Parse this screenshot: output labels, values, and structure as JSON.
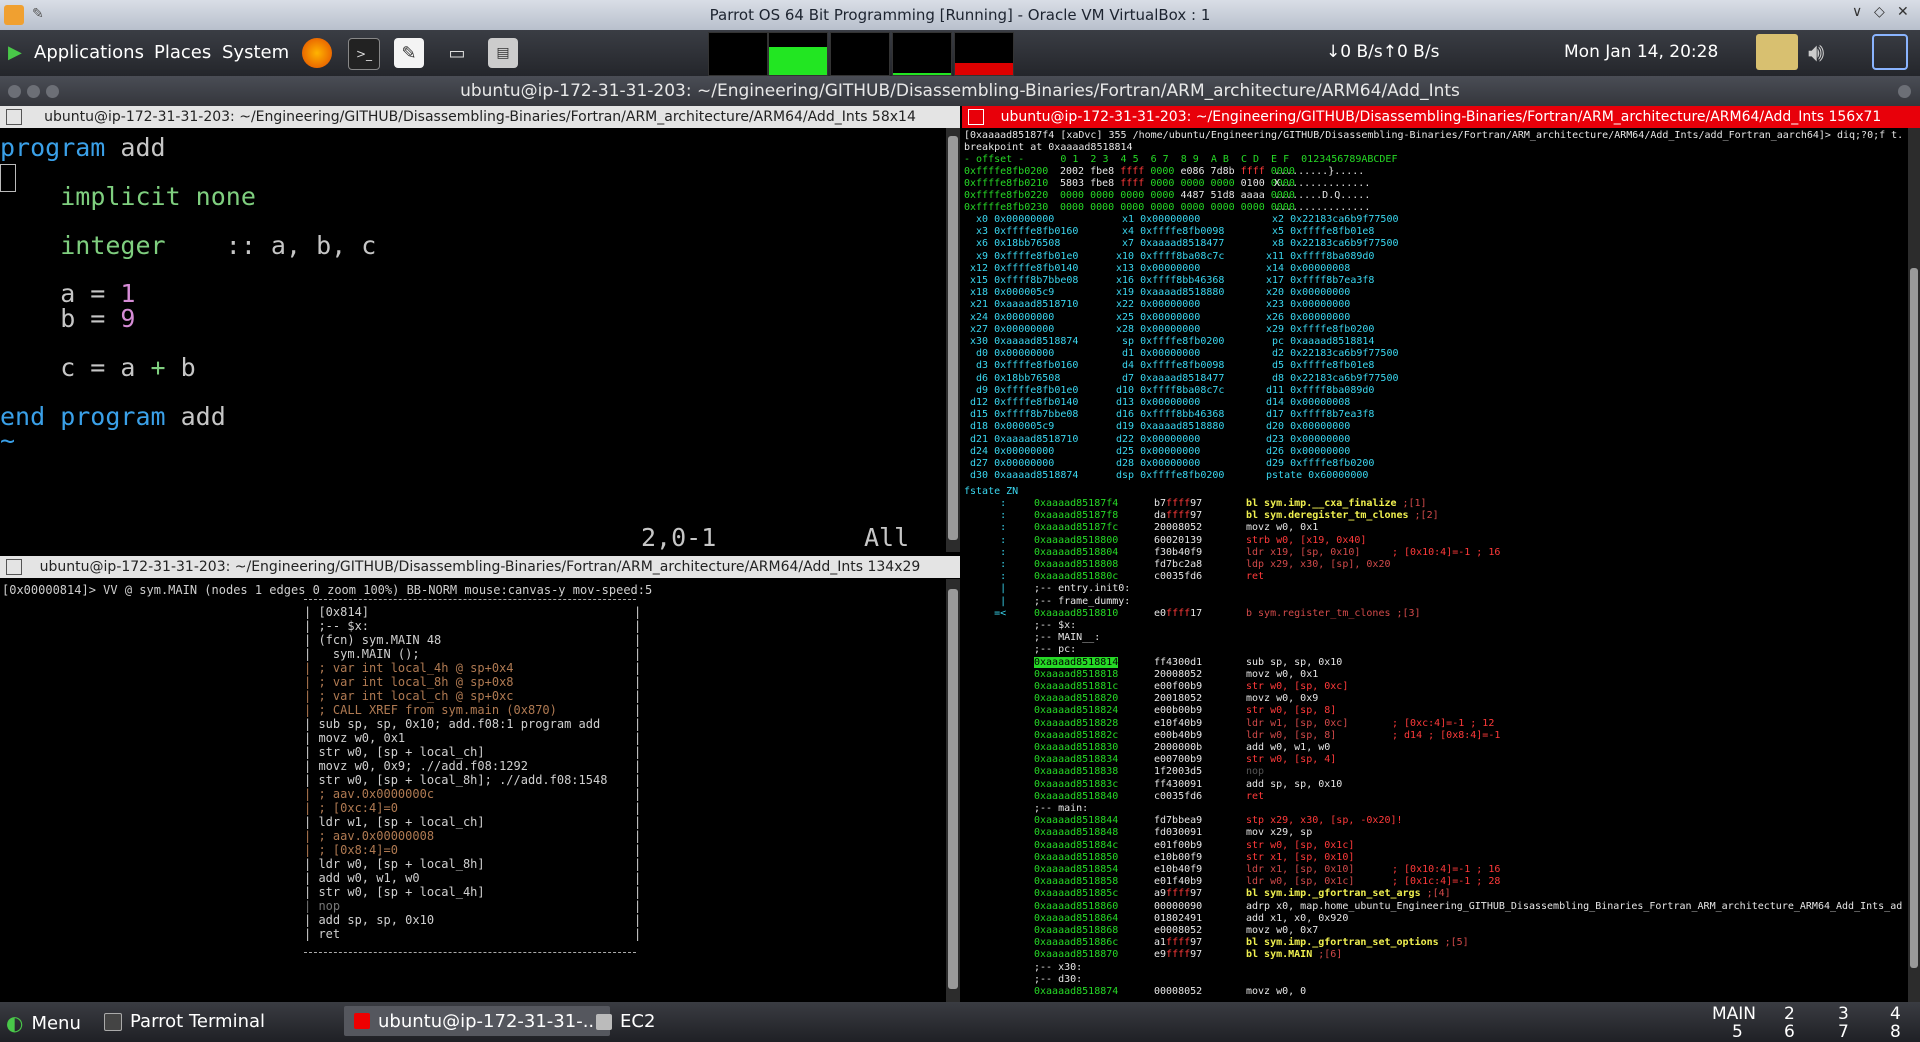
{
  "vbox": {
    "title": "Parrot OS 64 Bit Programming [Running] - Oracle VM VirtualBox : 1"
  },
  "panel": {
    "menus": [
      "Applications",
      "Places",
      "System"
    ],
    "network": "↓0 B/s↑0 B/s",
    "clock": "Mon Jan 14, 20:28"
  },
  "terminal": {
    "title": "ubuntu@ip-172-31-31-203: ~/Engineering/GITHUB/Disassembling-Binaries/Fortran/ARM_architecture/ARM64/Add_Ints"
  },
  "pane_vim": {
    "title": "ubuntu@ip-172-31-31-203: ~/Engineering/GITHUB/Disassembling-Binaries/Fortran/ARM_architecture/ARM64/Add_Ints 58x14",
    "status_pos": "2,0-1",
    "status_all": "All"
  },
  "pane_graph": {
    "title": "ubuntu@ip-172-31-31-203: ~/Engineering/GITHUB/Disassembling-Binaries/Fortran/ARM_architecture/ARM64/Add_Ints 134x29",
    "header": "[0x00000814]> VV @ sym.MAIN (nodes 1 edges 0 zoom 100%) BB-NORM mouse:canvas-y mov-speed:5",
    "lines": [
      {
        "t": "| [0x814]",
        "c": "n"
      },
      {
        "t": "| ;-- $x:",
        "c": "n"
      },
      {
        "t": "| (fcn) sym.MAIN 48",
        "c": "n"
      },
      {
        "t": "|   sym.MAIN ();",
        "c": "n"
      },
      {
        "t": "| ; var int local_4h @ sp+0x4",
        "c": "c"
      },
      {
        "t": "| ; var int local_8h @ sp+0x8",
        "c": "c"
      },
      {
        "t": "| ; var int local_ch @ sp+0xc",
        "c": "c"
      },
      {
        "t": "| ; CALL XREF from sym.main (0x870)",
        "c": "c"
      },
      {
        "t": "| sub sp, sp, 0x10; add.f08:1 program add",
        "c": "n"
      },
      {
        "t": "| movz w0, 0x1",
        "c": "n"
      },
      {
        "t": "| str w0, [sp + local_ch]",
        "c": "n"
      },
      {
        "t": "| movz w0, 0x9; .//add.f08:1292",
        "c": "n"
      },
      {
        "t": "| str w0, [sp + local_8h]; .//add.f08:1548",
        "c": "n"
      },
      {
        "t": "| ; aav.0x0000000c",
        "c": "c"
      },
      {
        "t": "| ; [0xc:4]=0",
        "c": "c"
      },
      {
        "t": "| ldr w1, [sp + local_ch]",
        "c": "n"
      },
      {
        "t": "| ; aav.0x00000008",
        "c": "c"
      },
      {
        "t": "| ; [0x8:4]=0",
        "c": "c"
      },
      {
        "t": "| ldr w0, [sp + local_8h]",
        "c": "n"
      },
      {
        "t": "| add w0, w1, w0",
        "c": "n"
      },
      {
        "t": "| str w0, [sp + local_4h]",
        "c": "n"
      },
      {
        "t": "| nop",
        "c": "g"
      },
      {
        "t": "| add sp, sp, 0x10",
        "c": "n"
      },
      {
        "t": "| ret",
        "c": "n"
      }
    ]
  },
  "pane_r2": {
    "title": "ubuntu@ip-172-31-31-203: ~/Engineering/GITHUB/Disassembling-Binaries/Fortran/ARM_architecture/ARM64/Add_Ints 156x71",
    "cmd": "[0xaaaad85187f4 [xaDvc] 355 /home/ubuntu/Engineering/GITHUB/Disassembling-Binaries/Fortran/ARM_architecture/ARM64/Add_Ints/add_Fortran_aarch64]> diq;?0;f t.",
    "breakpoint": "breakpoint at 0xaaaad8518814",
    "hexhdr": "- offset -      0 1  2 3  4 5  6 7  8 9  A B  C D  E F  0123456789ABCDEF",
    "hex": [
      {
        "a": "0xffffe8fb0200",
        "b": "2002 fbe8 ffff 0000 e086 7d8b ffff 0000",
        "s": " .........}....."
      },
      {
        "a": "0xffffe8fb0210",
        "b": "5803 fbe8 ffff 0000 0000 0000 0100 0000",
        "s": " X..............."
      },
      {
        "a": "0xffffe8fb0220",
        "b": "0000 0000 0000 0000 4487 51d8 aaaa 0000",
        "s": " ........D.Q....."
      },
      {
        "a": "0xffffe8fb0230",
        "b": "0000 0000 0000 0000 0000 0000 0000 0000",
        "s": " ................"
      }
    ],
    "regs": [
      [
        "  x0 0x00000000",
        "  x1 0x00000000",
        "  x2 0x22183ca6b9f77500"
      ],
      [
        "  x3 0xffffe8fb0160",
        "  x4 0xffffe8fb0098",
        "  x5 0xffffe8fb01e8"
      ],
      [
        "  x6 0x18bb76508",
        "  x7 0xaaaad8518477",
        "  x8 0x22183ca6b9f77500"
      ],
      [
        "  x9 0xffffe8fb01e0",
        " x10 0xffff8ba08c7c",
        " x11 0xffff8ba089d0"
      ],
      [
        " x12 0xffffe8fb0140",
        " x13 0x00000000",
        " x14 0x00000008"
      ],
      [
        " x15 0xffff8b7bbe08",
        " x16 0xffff8bb46368",
        " x17 0xffff8b7ea3f8"
      ],
      [
        " x18 0x000005c9",
        " x19 0xaaaad8518880",
        " x20 0x00000000"
      ],
      [
        " x21 0xaaaad8518710",
        " x22 0x00000000",
        " x23 0x00000000"
      ],
      [
        " x24 0x00000000",
        " x25 0x00000000",
        " x26 0x00000000"
      ],
      [
        " x27 0x00000000",
        " x28 0x00000000",
        " x29 0xffffe8fb0200"
      ],
      [
        " x30 0xaaaad8518874",
        "  sp 0xffffe8fb0200",
        "  pc 0xaaaad8518814"
      ],
      [
        "  d0 0x00000000",
        "  d1 0x00000000",
        "  d2 0x22183ca6b9f77500"
      ],
      [
        "  d3 0xffffe8fb0160",
        "  d4 0xffffe8fb0098",
        "  d5 0xffffe8fb01e8"
      ],
      [
        "  d6 0x18bb76508",
        "  d7 0xaaaad8518477",
        "  d8 0x22183ca6b9f77500"
      ],
      [
        "  d9 0xffffe8fb01e0",
        " d10 0xffff8ba08c7c",
        " d11 0xffff8ba089d0"
      ],
      [
        " d12 0xffffe8fb0140",
        " d13 0x00000000",
        " d14 0x00000008"
      ],
      [
        " d15 0xffff8b7bbe08",
        " d16 0xffff8bb46368",
        " d17 0xffff8b7ea3f8"
      ],
      [
        " d18 0x000005c9",
        " d19 0xaaaad8518880",
        " d20 0x00000000"
      ],
      [
        " d21 0xaaaad8518710",
        " d22 0x00000000",
        " d23 0x00000000"
      ],
      [
        " d24 0x00000000",
        " d25 0x00000000",
        " d26 0x00000000"
      ],
      [
        " d27 0x00000000",
        " d28 0x00000000",
        " d29 0xffffe8fb0200"
      ],
      [
        " d30 0xaaaad8518874",
        " dsp 0xffffe8fb0200",
        " pstate 0x60000000"
      ]
    ],
    "fstate": "fstate ZN",
    "disasm": [
      {
        "p": "      :",
        "a": "0xaaaad85187f4",
        "b": "b7ffff97",
        "i": "bl sym.imp.__cxa_finalize",
        "x": ";[1]",
        "k": "call"
      },
      {
        "p": "      :",
        "a": "0xaaaad85187f8",
        "b": "daffff97",
        "i": "bl sym.deregister_tm_clones",
        "x": ";[2]",
        "k": "call"
      },
      {
        "p": "      :",
        "a": "0xaaaad85187fc",
        "b": "20008052",
        "i": "movz w0, 0x1",
        "x": "",
        "k": "n"
      },
      {
        "p": "      :",
        "a": "0xaaaad8518800",
        "b": "60020139",
        "i": "strb w0, [x19, 0x40]",
        "x": "",
        "k": "st"
      },
      {
        "p": "      :",
        "a": "0xaaaad8518804",
        "b": "f30b40f9",
        "i": "ldr x19, [sp, 0x10]",
        "x": "; [0x10:4]=-1 ; 16",
        "k": "ld"
      },
      {
        "p": "      :",
        "a": "0xaaaad8518808",
        "b": "fd7bc2a8",
        "i": "ldp x29, x30, [sp], 0x20",
        "x": "",
        "k": "ld"
      },
      {
        "p": "      :",
        "a": "0xaaaad851880c",
        "b": "c0035fd6",
        "i": "ret",
        "x": "",
        "k": "ret"
      },
      {
        "p": "      |",
        "a": ";-- entry.init0:",
        "b": "",
        "i": "",
        "x": "",
        "k": "lbl"
      },
      {
        "p": "      |",
        "a": ";-- frame_dummy:",
        "b": "",
        "i": "",
        "x": "",
        "k": "lbl"
      },
      {
        "p": "     =<",
        "a": "0xaaaad8518810",
        "b": "e0ffff17",
        "i": "b sym.register_tm_clones",
        "x": ";[3]",
        "k": "jmp"
      },
      {
        "p": "       ",
        "a": ";-- $x:",
        "b": "",
        "i": "",
        "x": "",
        "k": "lbl"
      },
      {
        "p": "       ",
        "a": ";-- MAIN__:",
        "b": "",
        "i": "",
        "x": "",
        "k": "lbl"
      },
      {
        "p": "       ",
        "a": ";-- pc:",
        "b": "",
        "i": "",
        "x": "",
        "k": "lbl"
      },
      {
        "p": "       ",
        "a": "0xaaaad8518814",
        "b": "ff4300d1",
        "i": "sub sp, sp, 0x10",
        "x": "",
        "k": "cur"
      },
      {
        "p": "       ",
        "a": "0xaaaad8518818",
        "b": "20008052",
        "i": "movz w0, 0x1",
        "x": "",
        "k": "n"
      },
      {
        "p": "       ",
        "a": "0xaaaad851881c",
        "b": "e00f00b9",
        "i": "str w0, [sp, 0xc]",
        "x": "",
        "k": "st"
      },
      {
        "p": "       ",
        "a": "0xaaaad8518820",
        "b": "20018052",
        "i": "movz w0, 0x9",
        "x": "",
        "k": "n"
      },
      {
        "p": "       ",
        "a": "0xaaaad8518824",
        "b": "e00b00b9",
        "i": "str w0, [sp, 8]",
        "x": "",
        "k": "st"
      },
      {
        "p": "       ",
        "a": "0xaaaad8518828",
        "b": "e10f40b9",
        "i": "ldr w1, [sp, 0xc]",
        "x": "; [0xc:4]=-1 ; 12",
        "k": "ld"
      },
      {
        "p": "       ",
        "a": "0xaaaad851882c",
        "b": "e00b40b9",
        "i": "ldr w0, [sp, 8]",
        "x": "; d14 ; [0x8:4]=-1",
        "k": "ld"
      },
      {
        "p": "       ",
        "a": "0xaaaad8518830",
        "b": "2000000b",
        "i": "add w0, w1, w0",
        "x": "",
        "k": "n"
      },
      {
        "p": "       ",
        "a": "0xaaaad8518834",
        "b": "e00700b9",
        "i": "str w0, [sp, 4]",
        "x": "",
        "k": "st"
      },
      {
        "p": "       ",
        "a": "0xaaaad8518838",
        "b": "1f2003d5",
        "i": "nop",
        "x": "",
        "k": "nop"
      },
      {
        "p": "       ",
        "a": "0xaaaad851883c",
        "b": "ff430091",
        "i": "add sp, sp, 0x10",
        "x": "",
        "k": "n"
      },
      {
        "p": "       ",
        "a": "0xaaaad8518840",
        "b": "c0035fd6",
        "i": "ret",
        "x": "",
        "k": "ret"
      },
      {
        "p": "       ",
        "a": ";-- main:",
        "b": "",
        "i": "",
        "x": "",
        "k": "lbl"
      },
      {
        "p": "       ",
        "a": "0xaaaad8518844",
        "b": "fd7bbea9",
        "i": "stp x29, x30, [sp, -0x20]!",
        "x": "",
        "k": "st"
      },
      {
        "p": "       ",
        "a": "0xaaaad8518848",
        "b": "fd030091",
        "i": "mov x29, sp",
        "x": "",
        "k": "n"
      },
      {
        "p": "       ",
        "a": "0xaaaad851884c",
        "b": "e01f00b9",
        "i": "str w0, [sp, 0x1c]",
        "x": "",
        "k": "st"
      },
      {
        "p": "       ",
        "a": "0xaaaad8518850",
        "b": "e10b00f9",
        "i": "str x1, [sp, 0x10]",
        "x": "",
        "k": "st"
      },
      {
        "p": "       ",
        "a": "0xaaaad8518854",
        "b": "e10b40f9",
        "i": "ldr x1, [sp, 0x10]",
        "x": "; [0x10:4]=-1 ; 16",
        "k": "ld"
      },
      {
        "p": "       ",
        "a": "0xaaaad8518858",
        "b": "e01f40b9",
        "i": "ldr w0, [sp, 0x1c]",
        "x": "; [0x1c:4]=-1 ; 28",
        "k": "ld"
      },
      {
        "p": "       ",
        "a": "0xaaaad851885c",
        "b": "a9ffff97",
        "i": "bl sym.imp._gfortran_set_args",
        "x": ";[4]",
        "k": "call"
      },
      {
        "p": "       ",
        "a": "0xaaaad8518860",
        "b": "00000090",
        "i": "adrp x0, map.home_ubuntu_Engineering_GITHUB_Disassembling_Binaries_Fortran_ARM_architecture_ARM64_Add_Ints_ad",
        "x": "",
        "k": "n"
      },
      {
        "p": "       ",
        "a": "0xaaaad8518864",
        "b": "01802491",
        "i": "add x1, x0, 0x920",
        "x": "",
        "k": "n"
      },
      {
        "p": "       ",
        "a": "0xaaaad8518868",
        "b": "e0008052",
        "i": "movz w0, 0x7",
        "x": "",
        "k": "n"
      },
      {
        "p": "       ",
        "a": "0xaaaad851886c",
        "b": "a1ffff97",
        "i": "bl sym.imp._gfortran_set_options",
        "x": ";[5]",
        "k": "call"
      },
      {
        "p": "       ",
        "a": "0xaaaad8518870",
        "b": "e9ffff97",
        "i": "bl sym.MAIN",
        "x": ";[6]",
        "k": "call"
      },
      {
        "p": "       ",
        "a": ";-- x30:",
        "b": "",
        "i": "",
        "x": "",
        "k": "lbl"
      },
      {
        "p": "       ",
        "a": ";-- d30:",
        "b": "",
        "i": "",
        "x": "",
        "k": "lbl"
      },
      {
        "p": "       ",
        "a": "0xaaaad8518874",
        "b": "00008052",
        "i": "movz w0, 0",
        "x": "",
        "k": "n"
      }
    ]
  },
  "taskbar": {
    "menu": "Menu",
    "items": [
      "Parrot Terminal",
      "ubuntu@ip-172-31-31-...",
      "EC2"
    ],
    "workspace_main": "MAIN",
    "workspaces": [
      "2",
      "3",
      "4",
      "5",
      "6",
      "7",
      "8"
    ]
  }
}
